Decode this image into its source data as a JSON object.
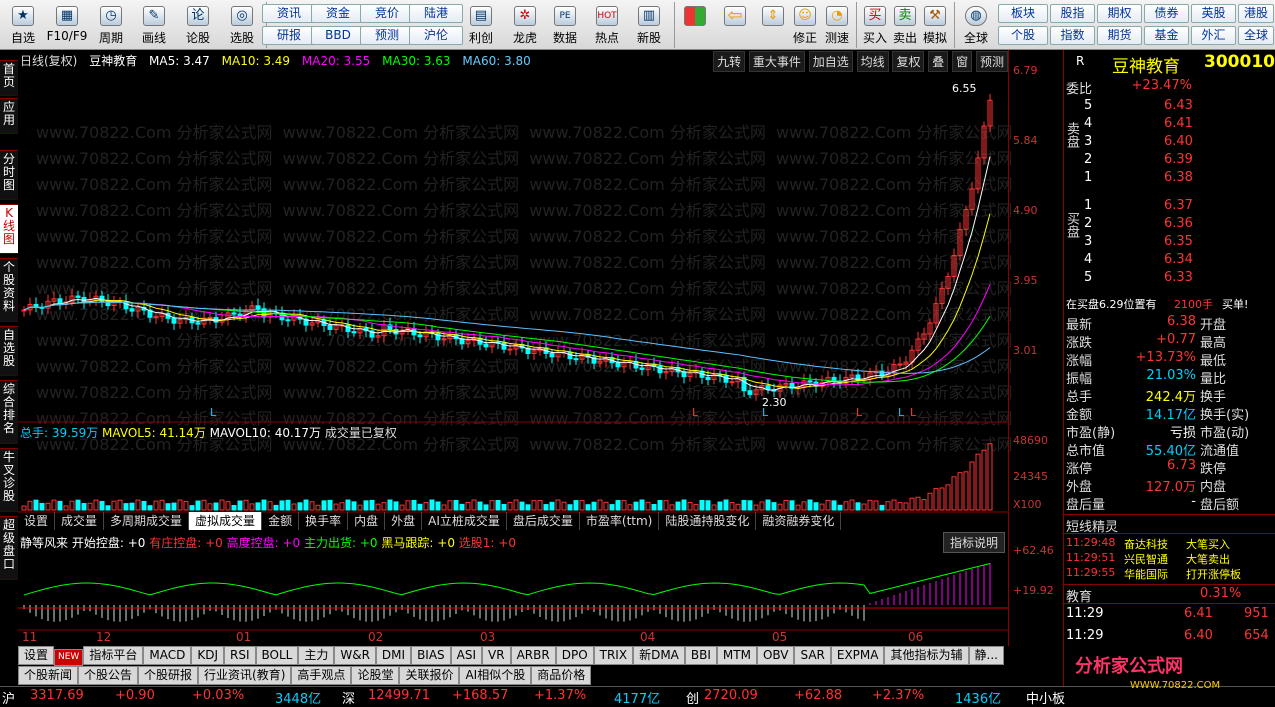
{
  "toolbar": {
    "buttons": [
      {
        "label": "自选",
        "icon": "star-icon"
      },
      {
        "label": "F10/F9",
        "icon": "f10-icon"
      },
      {
        "label": "周期",
        "icon": "clock-icon"
      },
      {
        "label": "画线",
        "icon": "pen-icon"
      },
      {
        "label": "论股",
        "icon": "discuss-icon"
      },
      {
        "label": "选股",
        "icon": "select-icon"
      }
    ],
    "small_buttons_row1": [
      "资讯",
      "资金",
      "竞价",
      "陆港"
    ],
    "small_buttons_row2": [
      "研报",
      "BBD",
      "预测",
      "沪伦"
    ],
    "buttons2": [
      {
        "label": "利创",
        "icon": "chart-icon"
      },
      {
        "label": "龙虎",
        "icon": "dragon-icon"
      },
      {
        "label": "数据",
        "icon": "pe-icon"
      },
      {
        "label": "热点",
        "icon": "hot-icon"
      },
      {
        "label": "新股",
        "icon": "new-stock-icon"
      }
    ],
    "buttons3": [
      {
        "label": "",
        "icon": "grid-icon"
      },
      {
        "label": "",
        "icon": "back-arrow-icon"
      },
      {
        "label": "",
        "icon": "updown-icon"
      },
      {
        "label": "修正",
        "icon": "fix-icon"
      },
      {
        "label": "测速",
        "icon": "speed-icon"
      },
      {
        "label": "买入",
        "icon": "buy-icon"
      },
      {
        "label": "卖出",
        "icon": "sell-icon"
      },
      {
        "label": "模拟",
        "icon": "hammer-icon"
      },
      {
        "label": "全球",
        "icon": "globe-icon"
      }
    ],
    "right_row1": [
      "板块",
      "股指",
      "期权",
      "债券",
      "英股",
      "港股"
    ],
    "right_row2": [
      "个股",
      "指数",
      "期货",
      "基金",
      "外汇",
      "全球"
    ]
  },
  "left_tabs": [
    "首页",
    "应用",
    "分时图",
    "K线图",
    "个股资料",
    "自选股",
    "综合排名",
    "牛叉诊股",
    "超级盘口"
  ],
  "chart": {
    "period": "日线(复权)",
    "stock_name": "豆神教育",
    "ma5": "MA5: 3.47",
    "ma10": "MA10: 3.49",
    "ma20": "MA20: 3.55",
    "ma30": "MA30: 3.63",
    "ma60": "MA60: 3.80",
    "top_buttons": [
      "九转",
      "重大事件",
      "加自选",
      "均线",
      "复权",
      "叠",
      "窗",
      "预测"
    ],
    "price_axis": [
      "6.79",
      "5.84",
      "4.90",
      "3.95",
      "3.01"
    ],
    "high_label": "6.55",
    "low_label": "2.30",
    "volume_line": {
      "total": "总手: 39.59万",
      "mavol5": "MAVOL5: 41.14万",
      "mavol10": "MAVOL10: 40.17万",
      "note": "成交量已复权"
    },
    "volume_axis": [
      "48690",
      "24345",
      "X100"
    ],
    "sub_tabs": [
      "设置",
      "成交量",
      "多周期成交量",
      "虚拟成交量",
      "金额",
      "换手率",
      "内盘",
      "外盘",
      "AI立桩成交量",
      "盘后成交量",
      "市盈率(ttm)",
      "陆股通持股变化",
      "融资融券变化"
    ],
    "indicator": {
      "name": "静等风来",
      "items": [
        "开始控盘: +0",
        "有庄控盘: +0",
        "高度控盘: +0",
        "主力出货: +0",
        "黑马跟踪: +0",
        "选股1: +0"
      ],
      "button": "指标说明",
      "axis": [
        "+62.46",
        "+19.92"
      ]
    },
    "dates": [
      "11",
      "12",
      "01",
      "02",
      "03",
      "04",
      "05",
      "06"
    ],
    "l_markers": [
      "L",
      "L",
      "L",
      "L",
      "L",
      "L"
    ]
  },
  "bottom_tabs": [
    "设置",
    "NEW",
    "指标平台",
    "MACD",
    "KDJ",
    "RSI",
    "BOLL",
    "主力",
    "W&R",
    "DMI",
    "BIAS",
    "ASI",
    "VR",
    "ARBR",
    "DPO",
    "TRIX",
    "新DMA",
    "BBI",
    "MTM",
    "OBV",
    "SAR",
    "EXPMA",
    "其他指标为辅",
    "静..."
  ],
  "bottom_tabs2": [
    "个股新闻",
    "个股公告",
    "个股研报",
    "行业资讯(教育)",
    "高手观点",
    "论股堂",
    "关联报价",
    "AI相似个股",
    "商品价格"
  ],
  "status": {
    "sh_label": "沪",
    "sh_val": "3317.69",
    "sh_chg": "+0.90",
    "sh_pct": "+0.03%",
    "sh_amt": "3448亿",
    "sz_label": "深",
    "sz_val": "12499.71",
    "sz_chg": "+168.57",
    "sz_pct": "+1.37%",
    "sz_amt": "4177亿",
    "cy_label": "创",
    "cy_val": "2720.09",
    "cy_chg": "+62.88",
    "cy_pct": "+2.37%",
    "cy_amt": "1436亿",
    "tail": "中小板"
  },
  "right_panel": {
    "tag": "R",
    "title": "豆神教育",
    "code": "300010",
    "weibi_label": "委比",
    "weibi": "+23.47%",
    "sell_label": "卖盘",
    "buy_label": "买盘",
    "sells": [
      {
        "n": "5",
        "p": "6.43"
      },
      {
        "n": "4",
        "p": "6.41"
      },
      {
        "n": "3",
        "p": "6.40"
      },
      {
        "n": "2",
        "p": "6.39"
      },
      {
        "n": "1",
        "p": "6.38"
      }
    ],
    "buys": [
      {
        "n": "1",
        "p": "6.37"
      },
      {
        "n": "2",
        "p": "6.36"
      },
      {
        "n": "3",
        "p": "6.35"
      },
      {
        "n": "4",
        "p": "6.34"
      },
      {
        "n": "5",
        "p": "6.33"
      }
    ],
    "buy_notice": "在买盘6.29位置有",
    "buy_notice_qty": "2100手",
    "buy_notice_tail": "买单!",
    "stats": [
      {
        "l": "最新",
        "v": "6.38",
        "l2": "开盘",
        "c": "red"
      },
      {
        "l": "涨跌",
        "v": "+0.77",
        "l2": "最高",
        "c": "red"
      },
      {
        "l": "涨幅",
        "v": "+13.73%",
        "l2": "最低",
        "c": "red"
      },
      {
        "l": "振幅",
        "v": "21.03%",
        "l2": "量比",
        "c": "cyan"
      },
      {
        "l": "总手",
        "v": "242.4万",
        "l2": "换手",
        "c": "yellow"
      },
      {
        "l": "金额",
        "v": "14.17亿",
        "l2": "换手(实)",
        "c": "cyan"
      },
      {
        "l": "市盈(静)",
        "v": "亏损",
        "l2": "市盈(动)",
        "c": "white"
      },
      {
        "l": "总市值",
        "v": "55.40亿",
        "l2": "流通值",
        "c": "cyan"
      },
      {
        "l": "涨停",
        "v": "6.73",
        "l2": "跌停",
        "c": "red"
      },
      {
        "l": "外盘",
        "v": "127.0万",
        "l2": "内盘",
        "c": "red"
      },
      {
        "l": "盘后量",
        "v": "-",
        "l2": "盘后额",
        "c": "white"
      }
    ],
    "sprite_title": "短线精灵",
    "sprites": [
      {
        "t": "11:29:48",
        "name": "奋达科技",
        "act": "大笔买入"
      },
      {
        "t": "11:29:51",
        "name": "兴民智通",
        "act": "大笔卖出"
      },
      {
        "t": "11:29:55",
        "name": "华能国际",
        "act": "打开涨停板"
      }
    ],
    "edu_label": "教育",
    "edu_pct": "0.31%",
    "ticks": [
      {
        "t": "11:29",
        "p": "6.41",
        "q": "951"
      },
      {
        "t": "11:29",
        "p": "6.40",
        "q": "654"
      }
    ]
  },
  "logo": {
    "text": "分析家公式网",
    "url": "WWW.70822.COM"
  },
  "watermark": "www.70822.Com 分析家公式网",
  "colors": {
    "up": "#ff3333",
    "down": "#00ffff",
    "ma5": "#ffffff",
    "ma10": "#ffff00",
    "ma20": "#ff00ff",
    "ma30": "#00ff00",
    "ma60": "#60c0ff"
  }
}
